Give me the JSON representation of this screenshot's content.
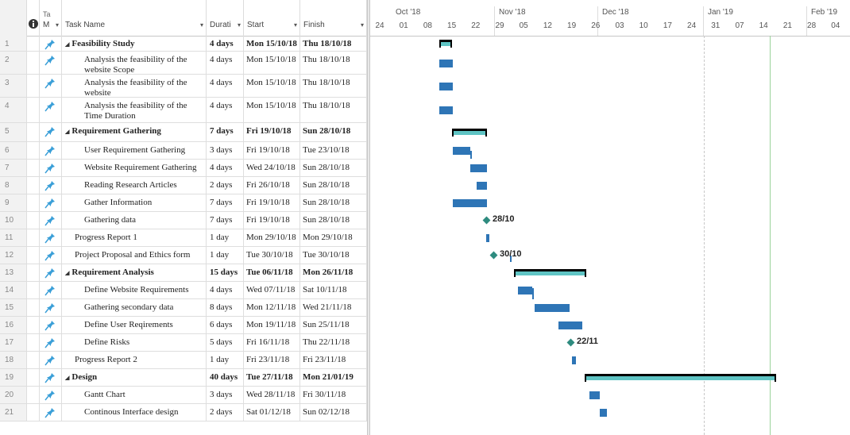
{
  "columns": {
    "info_icon": "i",
    "mode": "Ta\nM",
    "mode_top": "Ta",
    "mode_bottom": "M",
    "task_name": "Task Name",
    "duration": "Durati",
    "start": "Start",
    "finish": "Finish"
  },
  "timeline": {
    "months": [
      "Oct '18",
      "Nov '18",
      "Dec '18",
      "Jan '19",
      "Feb '19"
    ],
    "days": [
      "24",
      "01",
      "08",
      "15",
      "22",
      "29",
      "05",
      "12",
      "19",
      "26",
      "03",
      "10",
      "17",
      "24",
      "31",
      "07",
      "14",
      "21",
      "28",
      "04"
    ]
  },
  "tasks": [
    {
      "id": "1",
      "name": "Feasibility Study",
      "duration": "4 days",
      "start": "Mon 15/10/18",
      "finish": "Thu 18/10/18",
      "summary": true,
      "indent": 0
    },
    {
      "id": "2",
      "name": "Analysis the feasibility of the website Scope",
      "duration": "4 days",
      "start": "Mon 15/10/18",
      "finish": "Thu 18/10/18",
      "summary": false,
      "indent": 1
    },
    {
      "id": "3",
      "name": "Analysis the feasibility of the website",
      "duration": "4 days",
      "start": "Mon 15/10/18",
      "finish": "Thu 18/10/18",
      "summary": false,
      "indent": 1
    },
    {
      "id": "4",
      "name": "Analysis the feasibility of the Time Duration",
      "duration": "4 days",
      "start": "Mon 15/10/18",
      "finish": "Thu 18/10/18",
      "summary": false,
      "indent": 1
    },
    {
      "id": "5",
      "name": "Requirement Gathering",
      "duration": "7 days",
      "start": "Fri 19/10/18",
      "finish": "Sun 28/10/18",
      "summary": true,
      "indent": 0
    },
    {
      "id": "6",
      "name": "User Requirement Gathering",
      "duration": "3 days",
      "start": "Fri 19/10/18",
      "finish": "Tue 23/10/18",
      "summary": false,
      "indent": 1
    },
    {
      "id": "7",
      "name": "Website Requirement Gathering",
      "duration": "4 days",
      "start": "Wed 24/10/18",
      "finish": "Sun 28/10/18",
      "summary": false,
      "indent": 1
    },
    {
      "id": "8",
      "name": "Reading Research Articles",
      "duration": "2 days",
      "start": "Fri 26/10/18",
      "finish": "Sun 28/10/18",
      "summary": false,
      "indent": 1
    },
    {
      "id": "9",
      "name": "Gather Information",
      "duration": "7 days",
      "start": "Fri 19/10/18",
      "finish": "Sun 28/10/18",
      "summary": false,
      "indent": 1
    },
    {
      "id": "10",
      "name": "Gathering data",
      "duration": "7 days",
      "start": "Fri 19/10/18",
      "finish": "Sun 28/10/18",
      "summary": false,
      "indent": 1
    },
    {
      "id": "11",
      "name": "Progress Report 1",
      "duration": "1 day",
      "start": "Mon 29/10/18",
      "finish": "Mon 29/10/18",
      "summary": false,
      "indent": 0
    },
    {
      "id": "12",
      "name": "Project Proposal and Ethics form",
      "duration": "1 day",
      "start": "Tue 30/10/18",
      "finish": "Tue 30/10/18",
      "summary": false,
      "indent": 0
    },
    {
      "id": "13",
      "name": "Requirement Analysis",
      "duration": "15 days",
      "start": "Tue 06/11/18",
      "finish": "Mon 26/11/18",
      "summary": true,
      "indent": 0
    },
    {
      "id": "14",
      "name": "Define Website Requirements",
      "duration": "4 days",
      "start": "Wed 07/11/18",
      "finish": "Sat 10/11/18",
      "summary": false,
      "indent": 1
    },
    {
      "id": "15",
      "name": "Gathering secondary data",
      "duration": "8 days",
      "start": "Mon 12/11/18",
      "finish": "Wed 21/11/18",
      "summary": false,
      "indent": 1
    },
    {
      "id": "16",
      "name": "Define User Reqirements",
      "duration": "6 days",
      "start": "Mon 19/11/18",
      "finish": "Sun 25/11/18",
      "summary": false,
      "indent": 1
    },
    {
      "id": "17",
      "name": "Define Risks",
      "duration": "5 days",
      "start": "Fri 16/11/18",
      "finish": "Thu 22/11/18",
      "summary": false,
      "indent": 1
    },
    {
      "id": "18",
      "name": "Progress Report 2",
      "duration": "1 day",
      "start": "Fri 23/11/18",
      "finish": "Fri 23/11/18",
      "summary": false,
      "indent": 0
    },
    {
      "id": "19",
      "name": "Design",
      "duration": "40 days",
      "start": "Tue 27/11/18",
      "finish": "Mon 21/01/19",
      "summary": true,
      "indent": 0
    },
    {
      "id": "20",
      "name": "Gantt Chart",
      "duration": "3 days",
      "start": "Wed 28/11/18",
      "finish": "Fri 30/11/18",
      "summary": false,
      "indent": 1
    },
    {
      "id": "21",
      "name": "Continous Interface design",
      "duration": "2 days",
      "start": "Sat 01/12/18",
      "finish": "Sun 02/12/18",
      "summary": false,
      "indent": 1
    }
  ],
  "milestones": {
    "m10": "28/10",
    "m12": "30/10",
    "m17": "22/11"
  },
  "colors": {
    "task_bar": "#2e75b6",
    "summary_fill": "#5fc4c4",
    "milestone": "#2e8b7f",
    "pin_icon": "#3a9fd8"
  }
}
